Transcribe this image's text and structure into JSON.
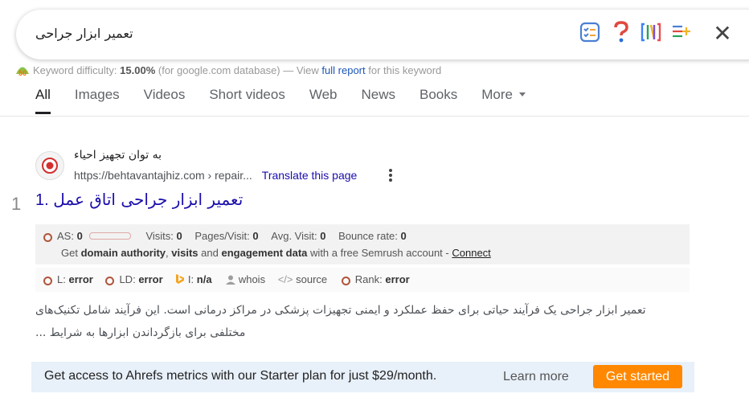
{
  "search": {
    "query": "تعمیر ابزار جراحی",
    "icons": [
      "checklist-icon",
      "question-icon",
      "bracket-logo-icon",
      "list-add-icon",
      "close-icon"
    ]
  },
  "keyword_difficulty": {
    "badge": "50",
    "label": "Keyword difficulty:",
    "value": "15.00%",
    "source": "(for google.com database) — View",
    "link": "full report",
    "suffix": "for this keyword"
  },
  "tabs": [
    {
      "label": "All",
      "active": true
    },
    {
      "label": "Images"
    },
    {
      "label": "Videos"
    },
    {
      "label": "Short videos"
    },
    {
      "label": "Web"
    },
    {
      "label": "News"
    },
    {
      "label": "Books"
    },
    {
      "label": "More"
    }
  ],
  "result": {
    "rank": "1",
    "site_name": "به توان تجهیز احیاء",
    "url": "https://behtavantajhiz.com › repair...",
    "translate": "Translate this page",
    "number": "1.",
    "title": "تعمیر ابزار جراحی اتاق عمل",
    "seo": {
      "as_label": "AS:",
      "as_value": "0",
      "visits_label": "Visits:",
      "visits_value": "0",
      "pv_label": "Pages/Visit:",
      "pv_value": "0",
      "avg_label": "Avg. Visit:",
      "avg_value": "0",
      "bounce_label": "Bounce rate:",
      "bounce_value": "0",
      "get": "Get",
      "da": "domain authority",
      "comma": ",",
      "visits_bold": "visits",
      "and": "and",
      "eng": "engagement data",
      "free": "with a free Semrush account -",
      "connect": "Connect",
      "l_label": "L:",
      "l_value": "error",
      "ld_label": "LD:",
      "ld_value": "error",
      "i_label": "I:",
      "i_value": "n/a",
      "whois": "whois",
      "source": "source",
      "rank_label": "Rank:",
      "rank_value": "error"
    },
    "snippet": "تعمیر ابزار جراحی یک فرآیند حیاتی برای حفظ عملکرد و ایمنی تجهیزات پزشکی در مراکز درمانی است. این فرآیند شامل تکنیک‌های مختلفی برای بازگرداندن ابزارها به شرایط ..."
  },
  "ahrefs": {
    "text": "Get access to Ahrefs metrics with our Starter plan for just $29/month.",
    "learn": "Learn more",
    "cta": "Get started",
    "cta_color": "#ff8800"
  }
}
